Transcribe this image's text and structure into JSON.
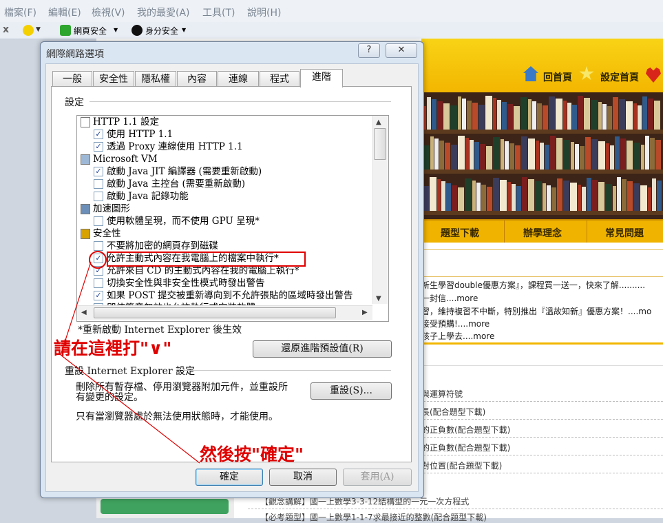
{
  "menu": [
    "檔案(F)",
    "編輯(E)",
    "檢視(V)",
    "我的最愛(A)",
    "工具(T)",
    "說明(H)"
  ],
  "commandbar": {
    "close_glyph": "x",
    "web_safety": "網頁安全",
    "id_safety": "身分安全"
  },
  "site": {
    "home": "回首頁",
    "set_home": "設定首頁",
    "nav": [
      "題型下載",
      "辦學理念",
      "常見問題"
    ],
    "news": [
      {
        "text": "新生學習double優惠方案』，課程買一送一，快來了解..........",
        "more": ""
      },
      {
        "text": "一封信....",
        "more": "more"
      },
      {
        "text": "習，維持複習不中斷，特別推出『溫故知新』優惠方案！....",
        "more": "mo"
      },
      {
        "text": "接受預購!....",
        "more": "more"
      },
      {
        "text": "孩子上學去....",
        "more": "more"
      }
    ],
    "list": [
      "與運算符號",
      "長(配合題型下載)",
      "的正負數(配合題型下載)",
      "的正負數(配合題型下載)",
      "對位置(配合題型下載)"
    ],
    "bottom": [
      "【觀念講解】國一上數學3-3-12結構型的一元一次方程式",
      "【必考題型】國一上數學1-1-7求最接近的整數(配合題型下載)"
    ]
  },
  "dialog": {
    "title": "網際網路選項",
    "help_btn": "?",
    "close_btn": "✕",
    "tabs": [
      "一般",
      "安全性",
      "隱私權",
      "內容",
      "連線",
      "程式",
      "進階"
    ],
    "active_tab": "進階",
    "settings_label": "設定",
    "tree": [
      {
        "type": "cat",
        "icon": "page",
        "label": "HTTP 1.1 設定"
      },
      {
        "type": "item",
        "checked": true,
        "label": "使用 HTTP 1.1"
      },
      {
        "type": "item",
        "checked": true,
        "label": "透過 Proxy 連線使用 HTTP 1.1"
      },
      {
        "type": "cat",
        "icon": "vm",
        "label": "Microsoft VM"
      },
      {
        "type": "item",
        "checked": true,
        "label": "啟動 Java JIT 編譯器 (需要重新啟動)"
      },
      {
        "type": "item",
        "checked": false,
        "label": "啟動 Java 主控台 (需要重新啟動)"
      },
      {
        "type": "item",
        "checked": false,
        "label": "啟動 Java 記錄功能"
      },
      {
        "type": "cat",
        "icon": "graphics",
        "label": "加速圖形"
      },
      {
        "type": "item",
        "checked": false,
        "label": "使用軟體呈現，而不使用 GPU 呈現*"
      },
      {
        "type": "cat",
        "icon": "lock",
        "label": "安全性"
      },
      {
        "type": "item",
        "checked": false,
        "label": "不要將加密的網頁存到磁碟"
      },
      {
        "type": "item",
        "checked": true,
        "label": "允許主動式內容在我電腦上的檔案中執行*"
      },
      {
        "type": "item",
        "checked": true,
        "label": "允許來自 CD 的主動式內容在我的電腦上執行*"
      },
      {
        "type": "item",
        "checked": false,
        "label": "切換安全性與非安全性模式時發出警告"
      },
      {
        "type": "item",
        "checked": true,
        "label": "如果 POST 提交被重新導向到不允許張貼的區域時發出警告"
      },
      {
        "type": "item",
        "checked": false,
        "label": "即使簽章無效也允許執行或安裝軟體"
      }
    ],
    "restart_note": "*重新啟動 Internet Explorer 後生效",
    "restore_btn": "還原進階預設值(R)",
    "reset_group": "重設 Internet Explorer 設定",
    "reset_desc_1": "刪除所有暫存檔、停用瀏覽器附加元件，並重設所",
    "reset_desc_2": "有變更的設定。",
    "reset_btn": "重設(S)...",
    "reset_note": "只有當瀏覽器處於無法使用狀態時，才能使用。",
    "ok_btn": "確定",
    "cancel_btn": "取消",
    "apply_btn": "套用(A)"
  },
  "annotations": {
    "check_here": "請在這裡打\"∨\"",
    "then_press": "然後按\"確定\""
  },
  "colors": {
    "annotation_red": "#e00000",
    "site_yellow": "#f3b600",
    "dialog_frame": "#dbe6f3"
  }
}
